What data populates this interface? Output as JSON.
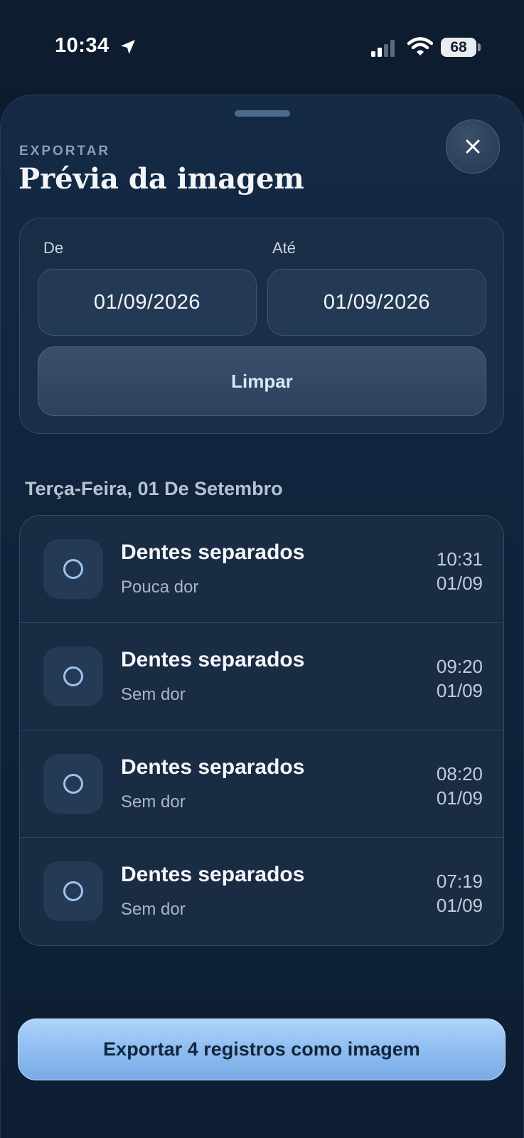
{
  "status_bar": {
    "time": "10:34",
    "battery": "68",
    "icons": [
      "location-arrow-icon",
      "cellular-signal-icon",
      "wifi-icon",
      "battery-icon"
    ]
  },
  "header": {
    "kicker": "EXPORTAR",
    "title": "Prévia da imagem",
    "close_icon": "close-icon"
  },
  "filter": {
    "from_label": "De",
    "to_label": "Até",
    "from_value": "01/09/2026",
    "to_value": "01/09/2026",
    "clear_label": "Limpar"
  },
  "day_header": "Terça-Feira, 01 De Setembro",
  "records": [
    {
      "title": "Dentes separados",
      "subtitle": "Pouca dor",
      "time": "10:31",
      "date": "01/09"
    },
    {
      "title": "Dentes separados",
      "subtitle": "Sem dor",
      "time": "09:20",
      "date": "01/09"
    },
    {
      "title": "Dentes separados",
      "subtitle": "Sem dor",
      "time": "08:20",
      "date": "01/09"
    },
    {
      "title": "Dentes separados",
      "subtitle": "Sem dor",
      "time": "07:19",
      "date": "01/09"
    }
  ],
  "export_label": "Exportar 4 registros como imagem",
  "colors": {
    "background": "#0c1b2d",
    "accent": "#8fbdf0",
    "ring": "#9cc3ee"
  }
}
